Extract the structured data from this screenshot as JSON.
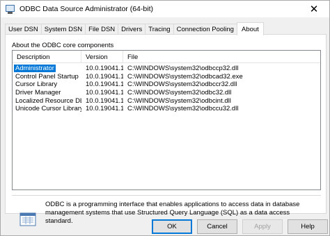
{
  "window": {
    "title": "ODBC Data Source Administrator (64-bit)",
    "close_glyph": "✕"
  },
  "tabs": [
    {
      "label": "User DSN",
      "active": false
    },
    {
      "label": "System DSN",
      "active": false
    },
    {
      "label": "File DSN",
      "active": false
    },
    {
      "label": "Drivers",
      "active": false
    },
    {
      "label": "Tracing",
      "active": false
    },
    {
      "label": "Connection Pooling",
      "active": false
    },
    {
      "label": "About",
      "active": true
    }
  ],
  "about": {
    "group_label": "About the ODBC core components",
    "columns": {
      "description": "Description",
      "version": "Version",
      "file": "File"
    },
    "rows": [
      {
        "description": "Administrator",
        "version": "10.0.19041.1",
        "file": "C:\\WINDOWS\\system32\\odbccp32.dll",
        "selected": true
      },
      {
        "description": "Control Panel Startup",
        "version": "10.0.19041.1",
        "file": "C:\\WINDOWS\\system32\\odbcad32.exe",
        "selected": false
      },
      {
        "description": "Cursor Library",
        "version": "10.0.19041.1",
        "file": "C:\\WINDOWS\\system32\\odbccr32.dll",
        "selected": false
      },
      {
        "description": "Driver Manager",
        "version": "10.0.19041.1",
        "file": "C:\\WINDOWS\\system32\\odbc32.dll",
        "selected": false
      },
      {
        "description": "Localized Resource DLL",
        "version": "10.0.19041.1",
        "file": "C:\\WINDOWS\\system32\\odbcint.dll",
        "selected": false
      },
      {
        "description": "Unicode Cursor Library",
        "version": "10.0.19041.1",
        "file": "C:\\WINDOWS\\system32\\odbccu32.dll",
        "selected": false
      }
    ],
    "info_text": "ODBC is a programming interface that enables applications to access data in database management systems that use Structured Query Language (SQL) as a data access standard.",
    "info_icon": "odbc-document-icon"
  },
  "buttons": {
    "ok": "OK",
    "cancel": "Cancel",
    "apply": "Apply",
    "help": "Help"
  },
  "colors": {
    "selection": "#0078d7",
    "accent": "#0078d7"
  }
}
